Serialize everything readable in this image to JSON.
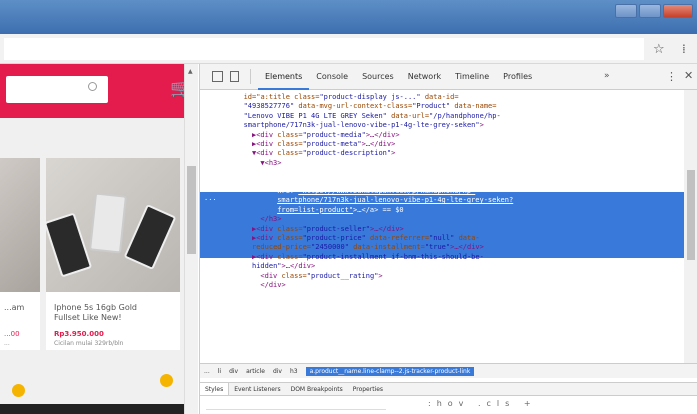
{
  "devtools": {
    "tabs": [
      {
        "label": "Elements",
        "active": true
      },
      {
        "label": "Console"
      },
      {
        "label": "Sources"
      },
      {
        "label": "Network"
      },
      {
        "label": "Timeline"
      },
      {
        "label": "Profiles"
      }
    ],
    "more_tabs": "»",
    "kebab": "⋮",
    "close": "✕",
    "selection_marker": "...",
    "dom_lines": [
      {
        "indent": 8,
        "html": "<span class='a'>id=\"a:title</span> <span class='a'>class=</span><span class='v'>\"product-display js-...\"</span> <span class='a'>data-id=</span>"
      },
      {
        "indent": 8,
        "html": "<span class='v'>\"4938527776\"</span> <span class='a'>data-mvg-url-context-class=</span><span class='v'>\"Product\"</span> <span class='a'>data-name=</span>"
      },
      {
        "indent": 8,
        "html": "<span class='v'>\"Lenovo VIBE P1 4G LTE GREY Seken\"</span> <span class='a'>data-url=</span><span class='v'>\"/p/handphone/hp-</span>"
      },
      {
        "indent": 8,
        "html": "<span class='v'>smartphone/717n3k-jual-lenovo-vibe-p1-4g-lte-grey-seken\"</span><span class='t'>&gt;</span>"
      },
      {
        "indent": 10,
        "html": "<span class='t'>▶&lt;div</span> <span class='a'>class=</span><span class='v'>\"product-media\"</span><span class='t'>&gt;…&lt;/div&gt;</span>"
      },
      {
        "indent": 10,
        "html": "<span class='t'>▶&lt;div</span> <span class='a'>class=</span><span class='v'>\"product-meta\"</span><span class='t'>&gt;…&lt;/div&gt;</span>"
      },
      {
        "indent": 10,
        "html": "<span class='t'>▼&lt;div</span> <span class='a'>class=</span><span class='v'>\"product-description\"</span><span class='t'>&gt;</span>"
      },
      {
        "indent": 12,
        "html": "<span class='t'>▼&lt;h3&gt;</span>"
      },
      {
        "indent": 14,
        "sel": true,
        "html": "<span class='t'>▶&lt;a</span> <span class='a'>title=</span><span class='v'>\"Lenovo VIBE P1 4G LTE GREY Seken\"</span> <span class='a'>class=</span>"
      },
      {
        "indent": 16,
        "sel": true,
        "html": "<span class='v'>\"product__name line-clamp--2 js-tracker-product-link\"</span>"
      },
      {
        "indent": 16,
        "sel": true,
        "html": "<span class='a'>href=</span><span class='u'>\"https://www.bukalapak.com/p/handphone/hp-</span>"
      },
      {
        "indent": 16,
        "sel": true,
        "html": "<span class='u'>smartphone/717n3k-jual-lenovo-vibe-p1-4g-lte-grey-seken?</span>"
      },
      {
        "indent": 16,
        "sel": true,
        "html": "<span class='u'>from=list-product\"</span><span class='t'>&gt;…&lt;/a&gt;</span> == $0"
      },
      {
        "indent": 12,
        "html": "<span class='t'>&lt;/h3&gt;</span>"
      },
      {
        "indent": 10,
        "html": "<span class='t'>▶&lt;div</span> <span class='a'>class=</span><span class='v'>\"product-seller\"</span><span class='t'>&gt;…&lt;/div&gt;</span>"
      },
      {
        "indent": 10,
        "html": "<span class='t'>▶&lt;div</span> <span class='a'>class=</span><span class='v'>\"product-price\"</span> <span class='a'>data-referrer=</span><span class='v'>\"null\"</span> <span class='a'>data-</span>"
      },
      {
        "indent": 10,
        "html": "<span class='a'>reduced-price=</span><span class='v'>\"2450000\"</span> <span class='a'>data-installment=</span><span class='v'>\"true\"</span><span class='t'>&gt;…&lt;/div&gt;</span>"
      },
      {
        "indent": 10,
        "html": "<span class='t'>▶&lt;div</span> <span class='a'>class=</span><span class='v'>\"product-installment if-bnm-this-should-be-</span>"
      },
      {
        "indent": 10,
        "html": "<span class='v'>hidden\"</span><span class='t'>&gt;…&lt;/div&gt;</span>"
      },
      {
        "indent": 12,
        "html": "<span class='t'>&lt;div</span> <span class='a'>class=</span><span class='v'>\"product__rating\"</span><span class='t'>&gt;</span>"
      },
      {
        "indent": 12,
        "html": "<span class='t'>&lt;/div&gt;</span>"
      }
    ],
    "breadcrumbs": [
      {
        "label": "..."
      },
      {
        "label": "li"
      },
      {
        "label": "div"
      },
      {
        "label": "article"
      },
      {
        "label": "div"
      },
      {
        "label": "h3"
      },
      {
        "label": "a.product__name.line-clamp--2.js-tracker-product-link",
        "active": true
      }
    ],
    "styles_tabs": [
      {
        "label": "Styles",
        "active": true
      },
      {
        "label": "Event Listeners"
      },
      {
        "label": "DOM Breakpoints"
      },
      {
        "label": "Properties"
      }
    ],
    "styles_buttons": ":hov .cls +"
  },
  "site": {
    "left_product": {
      "name": "...am",
      "price": "...00",
      "sub": "..."
    },
    "product": {
      "name": "Iphone 5s 16gb Gold Fullset Like New!",
      "price": "Rp3.950.000",
      "sub": "Cicilan mulai 329rb/bln"
    }
  },
  "colors": {
    "brand": "#e41c4e",
    "devtools_selection": "#3879d9"
  }
}
